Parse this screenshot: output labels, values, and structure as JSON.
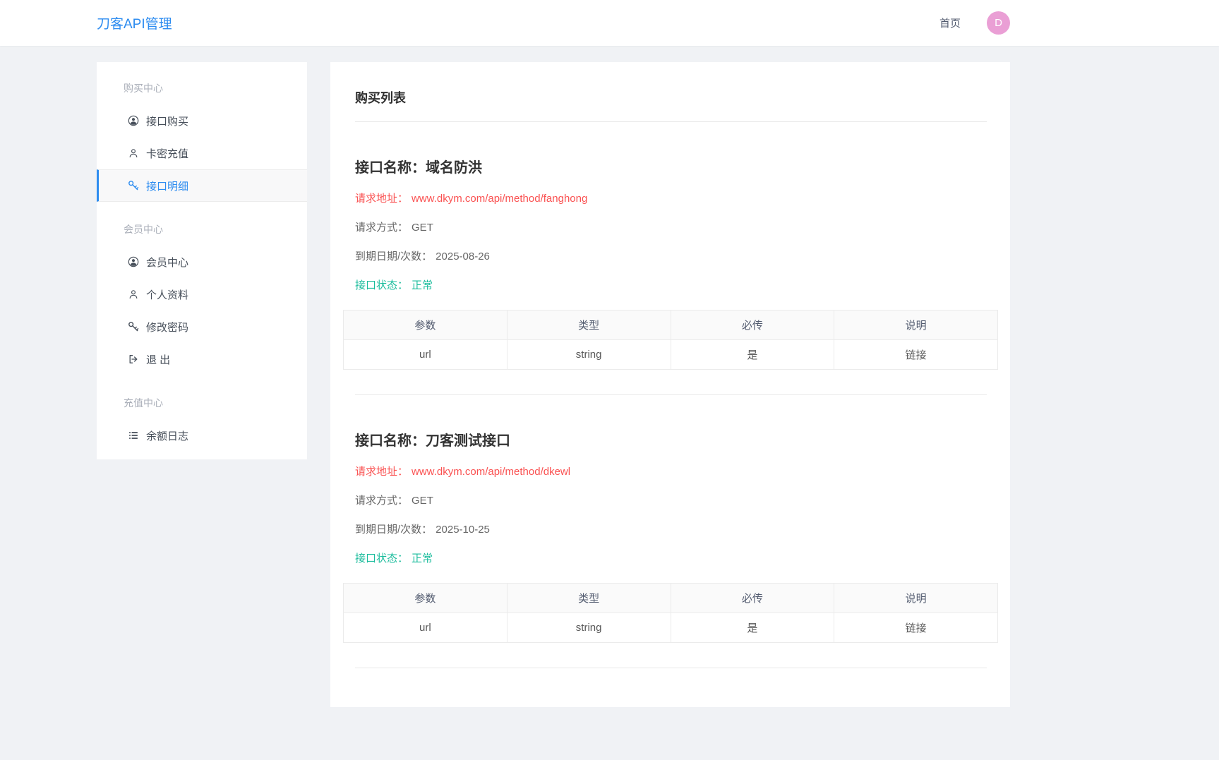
{
  "colors": {
    "primary": "#2d8cf0",
    "danger": "#fa5151",
    "success": "#1abc9c",
    "avatar_bg": "#ea9fd5"
  },
  "header": {
    "brand": "刀客API管理",
    "nav_home": "首页",
    "avatar_text": "D"
  },
  "sidebar": {
    "sections": [
      {
        "label": "购买中心",
        "items": [
          {
            "icon": "user-circle-icon",
            "label": "接口购买",
            "active": false
          },
          {
            "icon": "user-outline-icon",
            "label": "卡密充值",
            "active": false
          },
          {
            "icon": "key-icon",
            "label": "接口明细",
            "active": true
          }
        ]
      },
      {
        "label": "会员中心",
        "items": [
          {
            "icon": "user-circle-icon",
            "label": "会员中心",
            "active": false
          },
          {
            "icon": "user-outline-icon",
            "label": "个人资料",
            "active": false
          },
          {
            "icon": "key-icon",
            "label": "修改密码",
            "active": false
          },
          {
            "icon": "logout-icon",
            "label": "退 出",
            "active": false
          }
        ]
      },
      {
        "label": "充值中心",
        "items": [
          {
            "icon": "list-icon",
            "label": "余额日志",
            "active": false
          }
        ]
      }
    ]
  },
  "main": {
    "title": "购买列表",
    "table_headers": [
      "参数",
      "类型",
      "必传",
      "说明"
    ],
    "apis": [
      {
        "name_label": "接口名称：",
        "name": "域名防洪",
        "url_label": "请求地址：",
        "url": "www.dkym.com/api/method/fanghong",
        "method_label": "请求方式：",
        "method": "GET",
        "expire_label": "到期日期/次数：",
        "expire": "2025-08-26",
        "status_label": "接口状态：",
        "status": "正常",
        "params": [
          [
            "url",
            "string",
            "是",
            "链接"
          ]
        ]
      },
      {
        "name_label": "接口名称：",
        "name": "刀客测试接口",
        "url_label": "请求地址：",
        "url": "www.dkym.com/api/method/dkewl",
        "method_label": "请求方式：",
        "method": "GET",
        "expire_label": "到期日期/次数：",
        "expire": "2025-10-25",
        "status_label": "接口状态：",
        "status": "正常",
        "params": [
          [
            "url",
            "string",
            "是",
            "链接"
          ]
        ]
      }
    ]
  }
}
